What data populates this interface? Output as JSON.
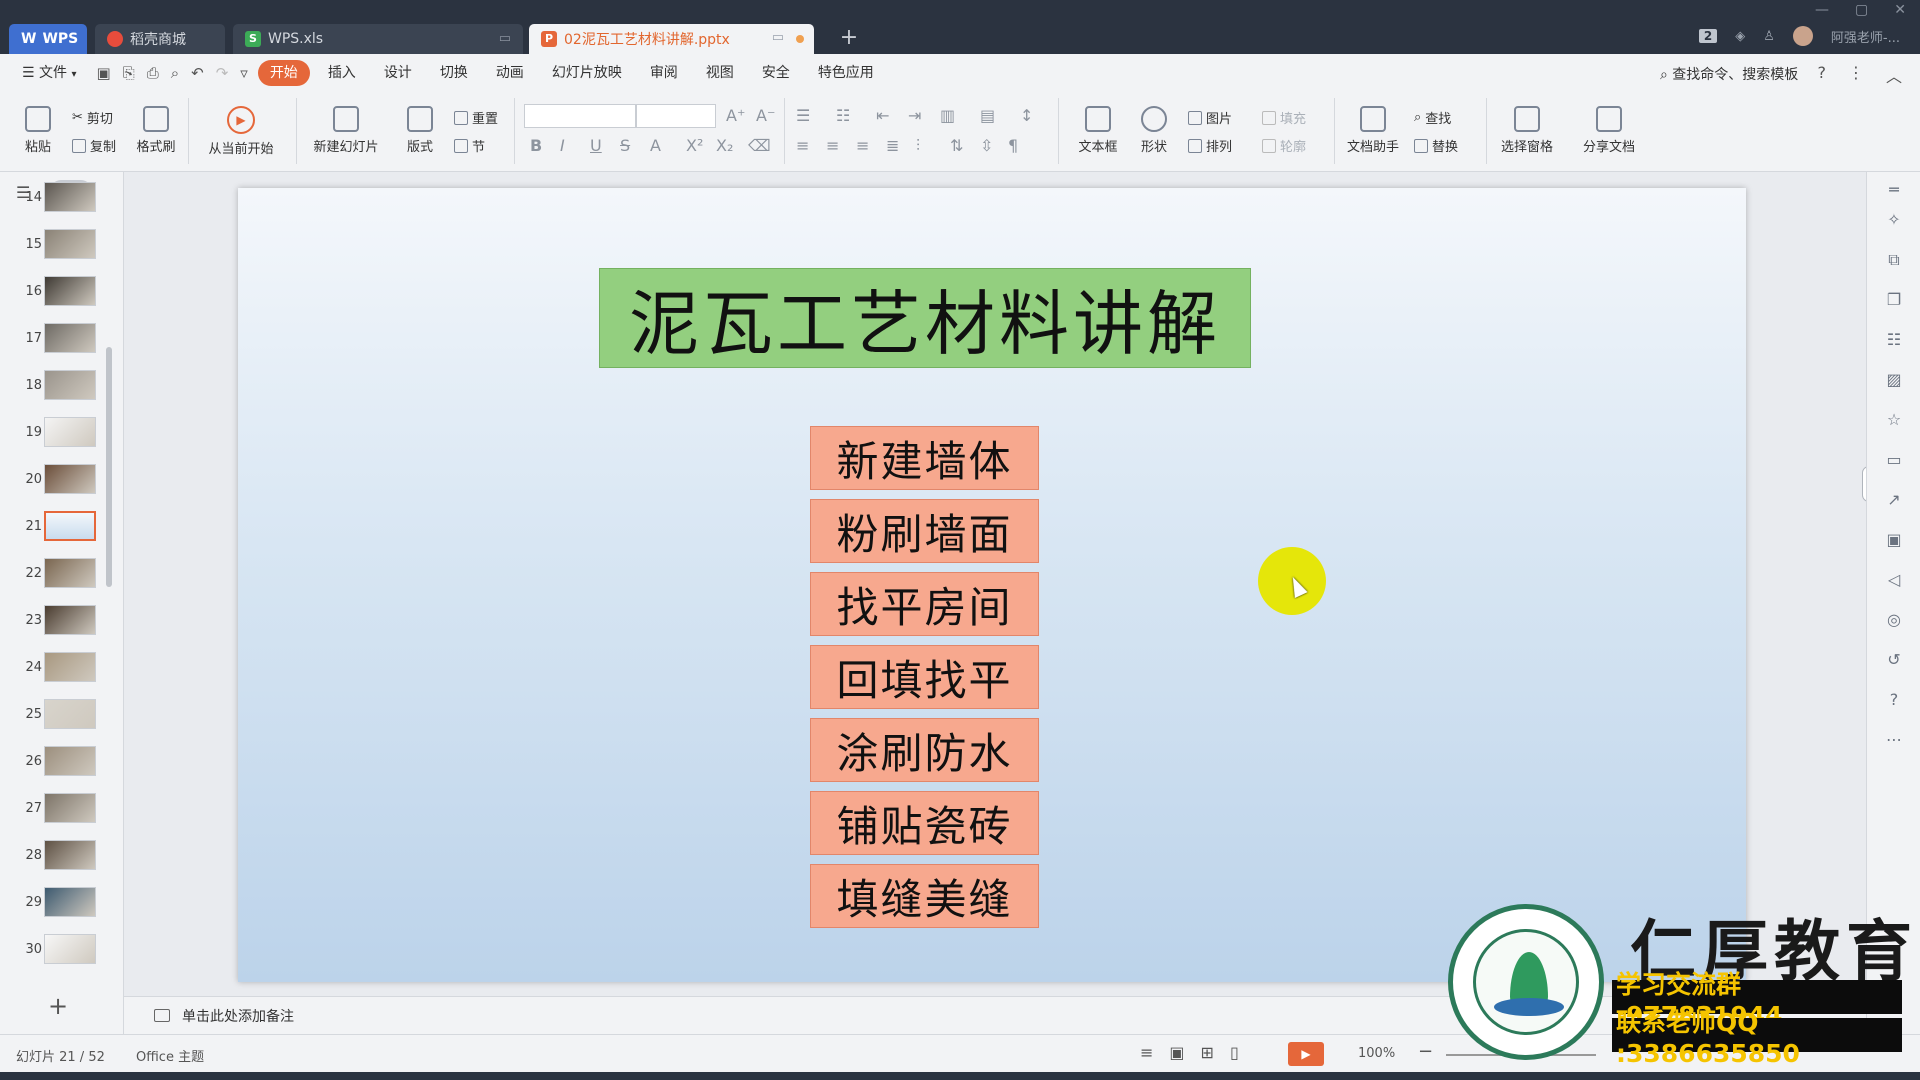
{
  "titlebar": {
    "tabs": [
      {
        "label": "WPS"
      },
      {
        "label": "稻壳商城"
      },
      {
        "label": "WPS.xls"
      },
      {
        "label": "02泥瓦工艺材料讲解.pptx"
      }
    ],
    "new_tab": "+",
    "badge": "2",
    "user": "阿强老师-..."
  },
  "menubar": {
    "file": "文件",
    "items": [
      "开始",
      "插入",
      "设计",
      "切换",
      "动画",
      "幻灯片放映",
      "审阅",
      "视图",
      "安全",
      "特色应用"
    ],
    "search": "查找命令、搜索模板"
  },
  "ribbon": {
    "paste": "粘贴",
    "cut": "剪切",
    "copy": "复制",
    "format_painter": "格式刷",
    "play_from_current": "从当前开始",
    "new_slide": "新建幻灯片",
    "layout": "版式",
    "reset": "重置",
    "section": "节",
    "textbox": "文本框",
    "shape": "形状",
    "picture": "图片",
    "arrange": "排列",
    "fill": "填充",
    "outline": "轮廓",
    "doc_assistant": "文档助手",
    "find": "查找",
    "replace": "替换",
    "select_pane": "选择窗格",
    "share_doc": "分享文档"
  },
  "thumbnails": {
    "numbers": [
      "14",
      "15",
      "16",
      "17",
      "18",
      "19",
      "20",
      "21",
      "22",
      "23",
      "24",
      "25",
      "26",
      "27",
      "28",
      "29",
      "30"
    ],
    "selected": "21"
  },
  "slide": {
    "title": "泥瓦工艺材料讲解",
    "items": [
      "新建墙体",
      "粉刷墙面",
      "找平房间",
      "回填找平",
      "涂刷防水",
      "铺贴瓷砖",
      "填缝美缝"
    ]
  },
  "notes": {
    "placeholder": "单击此处添加备注"
  },
  "status": {
    "slide_counter": "幻灯片 21 / 52",
    "theme": "Office 主题",
    "zoom": "100%"
  },
  "watermark": {
    "brand": "仁厚教育",
    "line1": "学习交流群 :977831944",
    "line2": "联系老师QQ :3386635850"
  },
  "colors": {
    "accent": "#e5673a",
    "title_box": "#93cf7f",
    "item_box": "#f7a88e",
    "pointer": "#e5e60a"
  }
}
